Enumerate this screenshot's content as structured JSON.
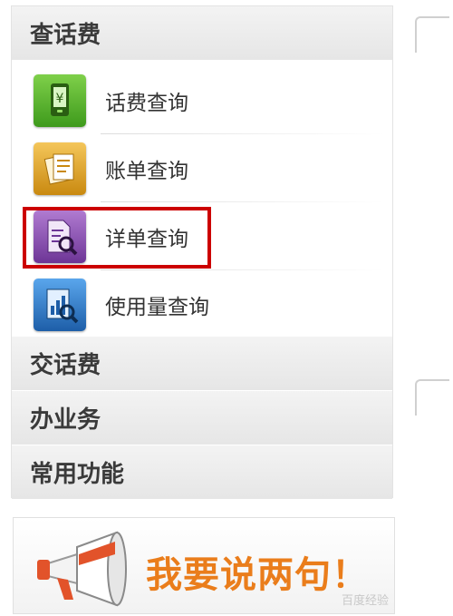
{
  "menu": {
    "sections": {
      "query_fees": "查话费",
      "pay_fees": "交话费",
      "handle_business": "办业务",
      "common_functions": "常用功能"
    },
    "items": [
      {
        "label": "话费查询",
        "icon": "phone-yuan-icon",
        "color": "#5cb531"
      },
      {
        "label": "账单查询",
        "icon": "bill-documents-icon",
        "color": "#e2a62b"
      },
      {
        "label": "详单查询",
        "icon": "document-magnifier-icon",
        "color": "#8a55b0"
      },
      {
        "label": "使用量查询",
        "icon": "usage-chart-magnifier-icon",
        "color": "#2f77c4"
      }
    ],
    "highlight_color": "#cc0000"
  },
  "banner": {
    "text": "我要说两句！",
    "icon": "megaphone-icon",
    "color": "#ea7d1b"
  },
  "watermark": {
    "text": "百度经验"
  }
}
